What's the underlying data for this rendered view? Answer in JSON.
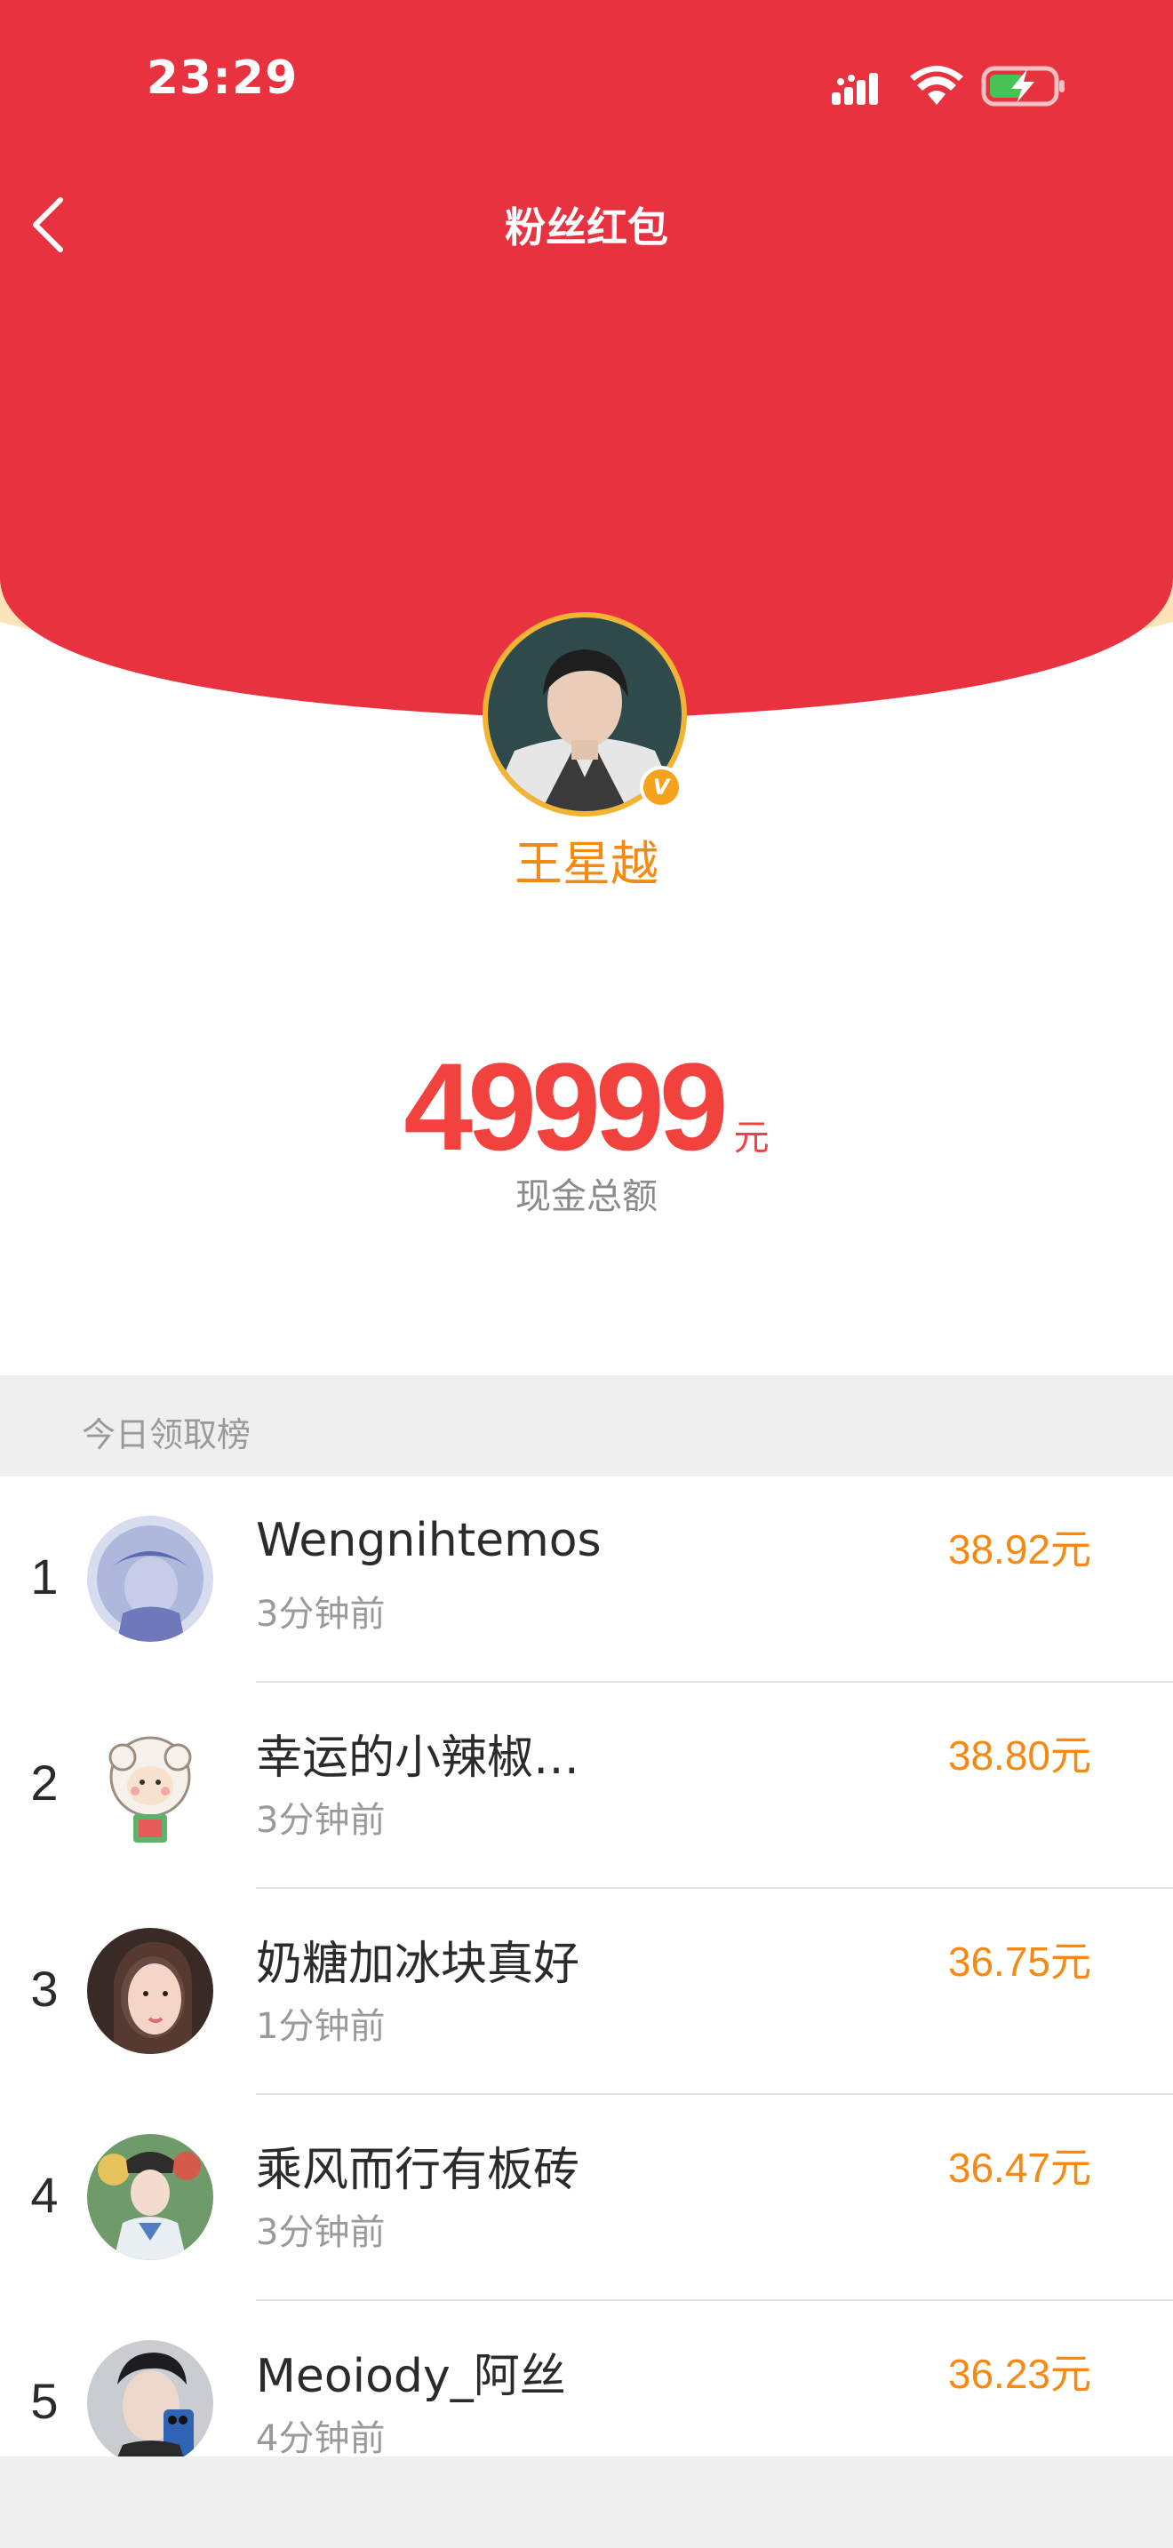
{
  "status_bar": {
    "time": "23:29"
  },
  "nav": {
    "title": "粉丝红包"
  },
  "profile": {
    "name": "王星越",
    "badge": "V"
  },
  "amount": {
    "value": "49999",
    "unit": "元",
    "label": "现金总额"
  },
  "leaderboard": {
    "title": "今日领取榜",
    "items": [
      {
        "rank": "1",
        "name": "Wengnihtemos",
        "time": "3分钟前",
        "amount": "38.92元"
      },
      {
        "rank": "2",
        "name": "幸运的小辣椒…",
        "time": "3分钟前",
        "amount": "38.80元"
      },
      {
        "rank": "3",
        "name": "奶糖加冰块真好",
        "time": "1分钟前",
        "amount": "36.75元"
      },
      {
        "rank": "4",
        "name": "乘风而行有板砖",
        "time": "3分钟前",
        "amount": "36.47元"
      },
      {
        "rank": "5",
        "name": "Meoiody_阿丝",
        "time": "4分钟前",
        "amount": "36.23元"
      }
    ]
  },
  "colors": {
    "header_red": "#e8323f",
    "accent_orange": "#f48a14",
    "amount_red": "#f2423e",
    "arc_cream": "#fce3b8"
  },
  "icons": [
    "signal-icon",
    "wifi-icon",
    "battery-charging-icon",
    "back-chevron-icon",
    "verified-badge-icon"
  ]
}
